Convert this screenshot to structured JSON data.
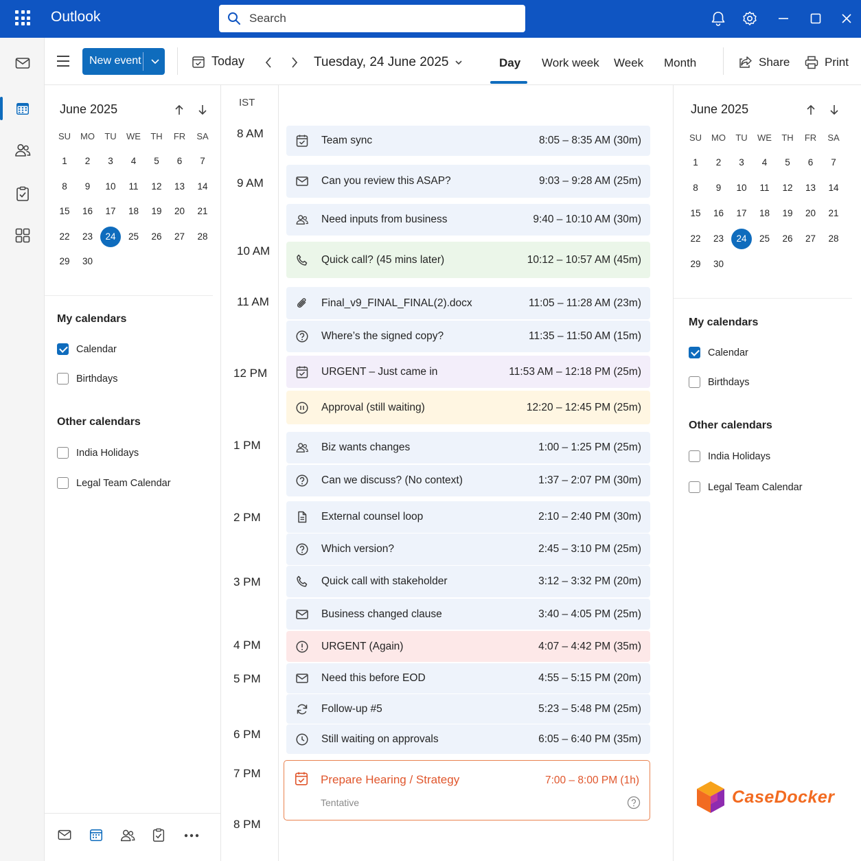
{
  "app": {
    "title": "Outlook"
  },
  "search": {
    "placeholder": "Search"
  },
  "toolbar": {
    "new_event": "New event",
    "today": "Today",
    "date": "Tuesday, 24 June 2025",
    "views": [
      "Day",
      "Work week",
      "Week",
      "Month"
    ],
    "active_view": "Day",
    "share": "Share",
    "print": "Print"
  },
  "mini_calendar": {
    "title": "June 2025",
    "dow": [
      "SU",
      "MO",
      "TU",
      "WE",
      "TH",
      "FR",
      "SA"
    ],
    "weeks": [
      [
        "1",
        "2",
        "3",
        "4",
        "5",
        "6",
        "7"
      ],
      [
        "8",
        "9",
        "10",
        "11",
        "12",
        "13",
        "14"
      ],
      [
        "15",
        "16",
        "17",
        "18",
        "19",
        "20",
        "21"
      ],
      [
        "22",
        "23",
        "24",
        "25",
        "26",
        "27",
        "28"
      ],
      [
        "29",
        "30",
        "",
        "",
        "",
        "",
        ""
      ]
    ],
    "selected": "24"
  },
  "calendars": {
    "my_title": "My calendars",
    "my": [
      {
        "label": "Calendar",
        "checked": true
      },
      {
        "label": "Birthdays",
        "checked": false
      }
    ],
    "other_title": "Other calendars",
    "other": [
      {
        "label": "India Holidays",
        "checked": false
      },
      {
        "label": "Legal Team Calendar",
        "checked": false
      }
    ]
  },
  "timeline": {
    "timezone": "IST",
    "hours": [
      "8 AM",
      "9 AM",
      "10 AM",
      "11 AM",
      "12 PM",
      "1 PM",
      "2 PM",
      "3 PM",
      "4 PM",
      "5 PM",
      "6 PM",
      "7 PM",
      "8 PM"
    ]
  },
  "events": [
    {
      "icon": "calendar-check-icon",
      "title": "Team sync",
      "time": "8:05 – 8:35 AM (30m)",
      "color": "blue"
    },
    {
      "icon": "mail-icon",
      "title": "Can you review this ASAP?",
      "time": "9:03 – 9:28 AM (25m)",
      "color": "blue"
    },
    {
      "icon": "people-icon",
      "title": "Need inputs from business",
      "time": "9:40 – 10:10 AM (30m)",
      "color": "blue"
    },
    {
      "icon": "phone-icon",
      "title": "Quick call? (45 mins later)",
      "time": "10:12 – 10:57 AM (45m)",
      "color": "green"
    },
    {
      "icon": "paperclip-icon",
      "title": "Final_v9_FINAL_FINAL(2).docx",
      "time": "11:05 – 11:28 AM (23m)",
      "color": "blue"
    },
    {
      "icon": "question-icon",
      "title": "Where’s the signed copy?",
      "time": "11:35 – 11:50 AM (15m)",
      "color": "blue"
    },
    {
      "icon": "calendar-check-icon",
      "title": "URGENT – Just came in",
      "time": "11:53 AM – 12:18 PM (25m)",
      "color": "purple"
    },
    {
      "icon": "pause-icon",
      "title": "Approval (still waiting)",
      "time": "12:20 – 12:45 PM (25m)",
      "color": "yellow"
    },
    {
      "icon": "people-icon",
      "title": "Biz wants changes",
      "time": "1:00 – 1:25 PM (25m)",
      "color": "blue"
    },
    {
      "icon": "question-icon",
      "title": "Can we discuss? (No context)",
      "time": "1:37 – 2:07 PM (30m)",
      "color": "blue"
    },
    {
      "icon": "document-icon",
      "title": "External counsel loop",
      "time": "2:10 – 2:40 PM (30m)",
      "color": "blue"
    },
    {
      "icon": "question-icon",
      "title": "Which version?",
      "time": "2:45 – 3:10 PM (25m)",
      "color": "blue"
    },
    {
      "icon": "phone-icon",
      "title": "Quick call with stakeholder",
      "time": "3:12 – 3:32 PM (20m)",
      "color": "blue"
    },
    {
      "icon": "mail-icon",
      "title": "Business changed clause",
      "time": "3:40 – 4:05 PM (25m)",
      "color": "blue"
    },
    {
      "icon": "alert-icon",
      "title": "URGENT (Again)",
      "time": "4:07 – 4:42 PM (35m)",
      "color": "red"
    },
    {
      "icon": "mail-icon",
      "title": "Need this before EOD",
      "time": "4:55 – 5:15 PM (20m)",
      "color": "blue"
    },
    {
      "icon": "refresh-icon",
      "title": "Follow-up #5",
      "time": "5:23 – 5:48 PM (25m)",
      "color": "blue"
    },
    {
      "icon": "clock-icon",
      "title": "Still waiting on approvals",
      "time": "6:05 – 6:40 PM (35m)",
      "color": "blue"
    }
  ],
  "tentative_event": {
    "icon": "calendar-check-icon",
    "title": "Prepare Hearing / Strategy",
    "time": "7:00 – 8:00 PM (1h)",
    "status": "Tentative",
    "accent": "#e0562c"
  },
  "brand": {
    "name": "CaseDocker"
  },
  "colors": {
    "accent": "#0f6cbd",
    "titlebar": "#0f55c2"
  }
}
